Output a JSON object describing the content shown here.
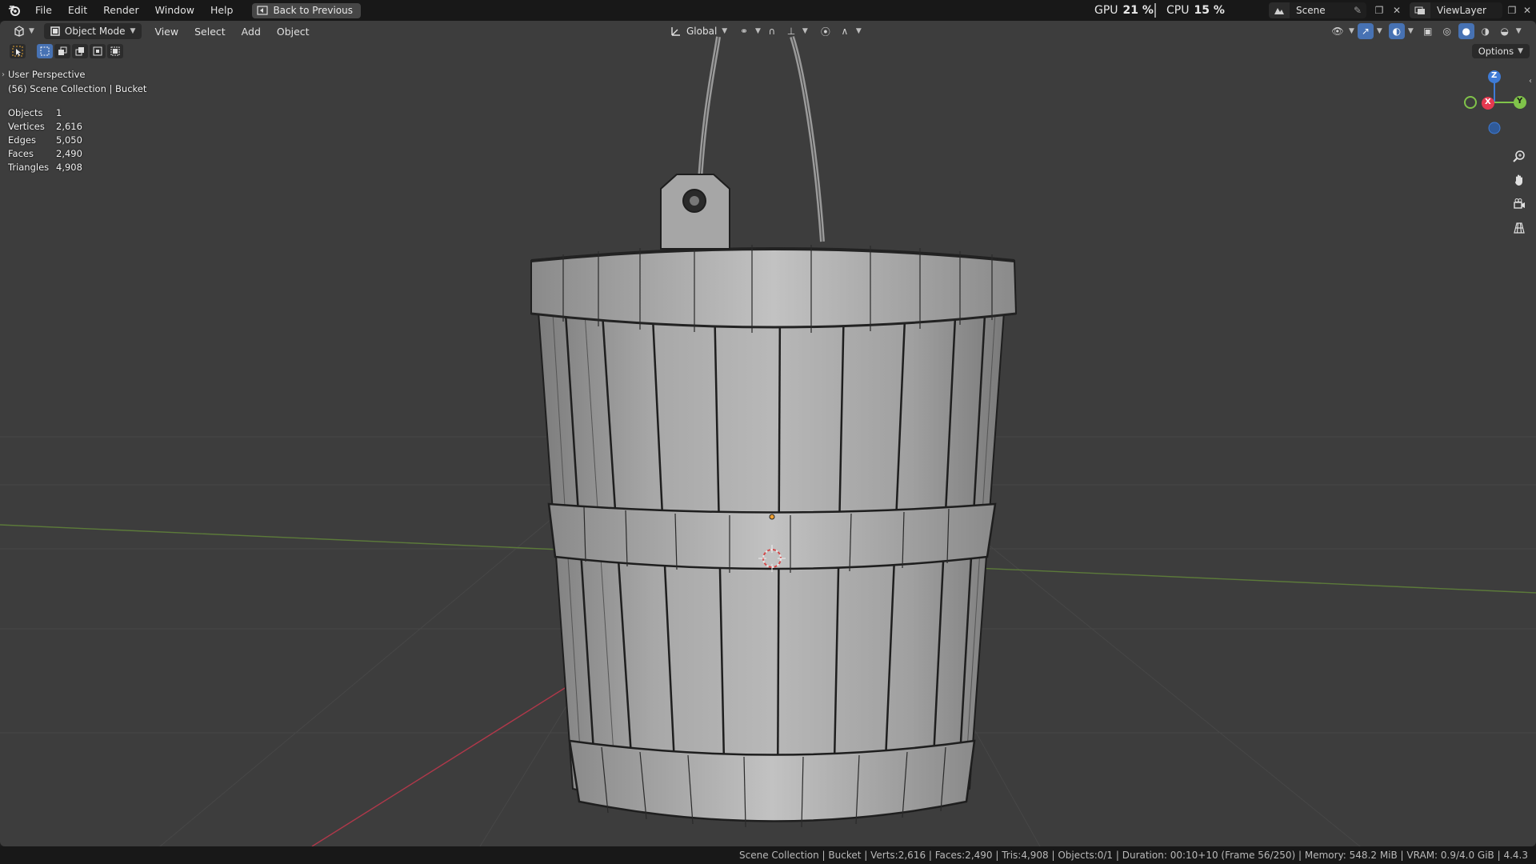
{
  "menubar": {
    "items": [
      "File",
      "Edit",
      "Render",
      "Window",
      "Help"
    ],
    "back_button": "Back to Previous",
    "gpu_label": "GPU",
    "gpu_value": "21 %",
    "cpu_label": "CPU",
    "cpu_value": "15 %",
    "scene": "Scene",
    "view_layer": "ViewLayer"
  },
  "viewport_header": {
    "mode": "Object Mode",
    "menus": [
      "View",
      "Select",
      "Add",
      "Object"
    ],
    "orientation": "Global",
    "options": "Options"
  },
  "overlay": {
    "perspective": "User Perspective",
    "collection": "(56) Scene Collection | Bucket",
    "stats": [
      {
        "label": "Objects",
        "value": "1"
      },
      {
        "label": "Vertices",
        "value": "2,616"
      },
      {
        "label": "Edges",
        "value": "5,050"
      },
      {
        "label": "Faces",
        "value": "2,490"
      },
      {
        "label": "Triangles",
        "value": "4,908"
      }
    ]
  },
  "gizmo": {
    "z": "Z",
    "x": "X",
    "y": "Y"
  },
  "statusbar": {
    "text": "Scene Collection | Bucket | Verts:2,616 | Faces:2,490 | Tris:4,908 | Objects:0/1 | Duration: 00:10+10 (Frame 56/250) | Memory: 548.2 MiB | VRAM: 0.9/4.0 GiB | 4.4.3"
  },
  "colors": {
    "accent": "#4772b3",
    "x_axis": "#e63950",
    "y_axis": "#80c34a",
    "z_axis": "#3e7bd6"
  }
}
